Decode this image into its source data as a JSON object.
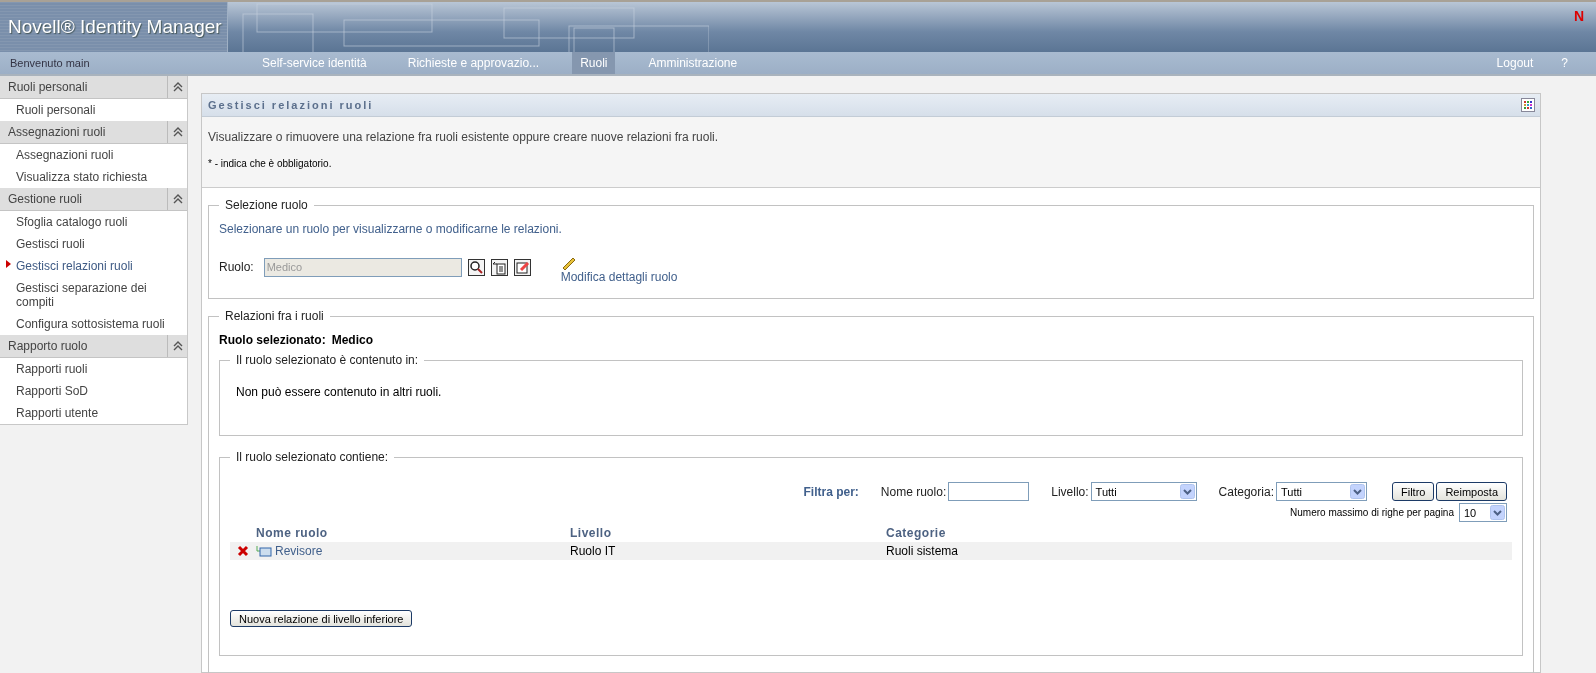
{
  "header": {
    "title": "Novell® Identity Manager",
    "logo_mark": "N"
  },
  "nav": {
    "welcome": "Benvenuto main",
    "tabs": [
      {
        "label": "Self-service identità",
        "selected": false
      },
      {
        "label": "Richieste e approvazio...",
        "selected": false
      },
      {
        "label": "Ruoli",
        "selected": true
      },
      {
        "label": "Amministrazione",
        "selected": false
      }
    ],
    "links": [
      "Logout",
      "?"
    ]
  },
  "sidebar": {
    "sections": [
      {
        "title": "Ruoli personali",
        "expanded": true,
        "items": [
          {
            "label": "Ruoli personali",
            "selected": false
          }
        ]
      },
      {
        "title": "Assegnazioni ruoli",
        "expanded": true,
        "items": [
          {
            "label": "Assegnazioni ruoli",
            "selected": false
          },
          {
            "label": "Visualizza stato richiesta",
            "selected": false
          }
        ]
      },
      {
        "title": "Gestione ruoli",
        "expanded": true,
        "items": [
          {
            "label": "Sfoglia catalogo ruoli",
            "selected": false
          },
          {
            "label": "Gestisci ruoli",
            "selected": false
          },
          {
            "label": "Gestisci relazioni ruoli",
            "selected": true
          },
          {
            "label": "Gestisci separazione dei compiti",
            "selected": false
          },
          {
            "label": "Configura sottosistema ruoli",
            "selected": false
          }
        ]
      },
      {
        "title": "Rapporto ruolo",
        "expanded": true,
        "items": [
          {
            "label": "Rapporti ruoli",
            "selected": false
          },
          {
            "label": "Rapporti SoD",
            "selected": false
          },
          {
            "label": "Rapporti utente",
            "selected": false
          }
        ]
      }
    ]
  },
  "panel": {
    "title": "Gestisci relazioni ruoli",
    "description": "Visualizzare o rimuovere una relazione fra ruoli esistente oppure creare nuove relazioni fra ruoli.",
    "required_note": "* - indica che è obbligatorio.",
    "role_selection": {
      "legend": "Selezione ruolo",
      "hint": "Selezionare un ruolo per visualizzarne o modificarne le relazioni.",
      "field_label": "Ruolo:",
      "field_value": "Medico",
      "edit_link": "Modifica dettagli ruolo"
    },
    "relations": {
      "legend": "Relazioni fra i ruoli",
      "selected_label": "Ruolo selezionato:",
      "selected_value": "Medico",
      "contained_in": {
        "legend": "Il ruolo selezionato è contenuto in:",
        "message": "Non può essere contenuto in altri ruoli."
      },
      "contains": {
        "legend": "Il ruolo selezionato contiene:",
        "filter_label": "Filtra per:",
        "name_label": "Nome ruolo:",
        "level_label": "Livello:",
        "level_value": "Tutti",
        "category_label": "Categoria:",
        "category_value": "Tutti",
        "filter_button": "Filtro",
        "reset_button": "Reimposta",
        "rows_label": "Numero massimo di righe per pagina",
        "rows_value": "10",
        "columns": [
          "Nome ruolo",
          "Livello",
          "Categorie"
        ],
        "rows": [
          {
            "name": "Revisore",
            "level": "Ruolo IT",
            "category": "Ruoli sistema"
          }
        ],
        "add_button": "Nuova relazione di livello inferiore"
      }
    }
  }
}
